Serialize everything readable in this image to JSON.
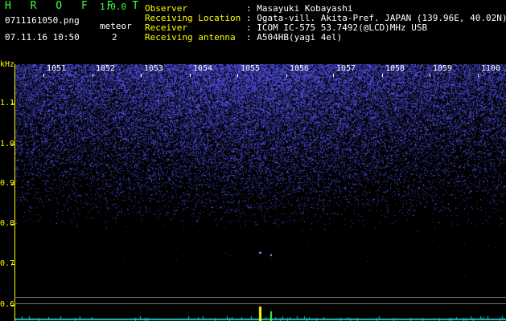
{
  "header": {
    "app_title": "H R O F F T",
    "version": "1.0.0",
    "filename": "0711161050.png",
    "datetime": "07.11.16 10:50",
    "meteor_label": "meteor",
    "meteor_count": "2"
  },
  "info": {
    "observer_key": "Observer",
    "observer_val": ": Masayuki Kobayashi",
    "location_key": "Receiving Location",
    "location_val": ": Ogata-vill. Akita-Pref. JAPAN (139.96E, 40.02N)",
    "receiver_key": "Receiver",
    "receiver_val": ": ICOM IC-575 53.7492(@LCD)MHz USB",
    "antenna_key": "Receiving antenna",
    "antenna_val": ": A504HB(yagi 4el)"
  },
  "axis": {
    "unit": "kHz",
    "y_ticks": [
      "1.1",
      "1.0",
      "0.9",
      "0.8",
      "0.7",
      "0.6"
    ],
    "x_ticks": [
      "1051",
      "1052",
      "1053",
      "1054",
      "1055",
      "1056",
      "1057",
      "1058",
      "1059",
      "1100"
    ]
  },
  "colors": {
    "noise": "#3a3aff",
    "signal": "#ffff00",
    "label": "#ffff00",
    "title": "#3cff3c"
  }
}
